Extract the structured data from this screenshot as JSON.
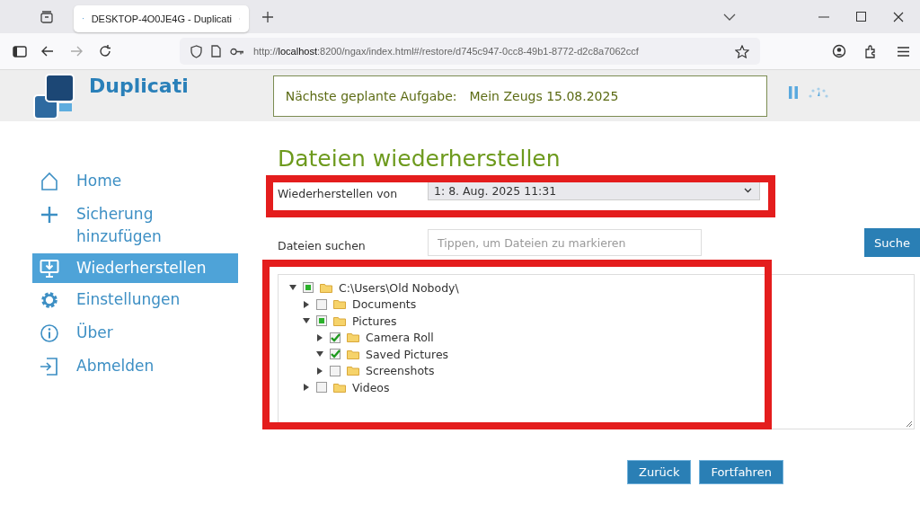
{
  "browser": {
    "tab_title": "DESKTOP-4O0JE4G - Duplicati",
    "url_prefix": "http://",
    "url_host": "localhost",
    "url_rest": ":8200/ngax/index.html#/restore/d745c947-0cc8-49b1-8772-d2c8a7062ccf"
  },
  "app": {
    "logo": "Duplicati",
    "next_task_label": "Nächste geplante Aufgabe:",
    "next_task_value": "Mein Zeugs 15.08.2025"
  },
  "sidebar": {
    "items": [
      {
        "label": "Home",
        "kind": "home",
        "selected": false
      },
      {
        "label": "Sicherung hinzufügen",
        "kind": "add",
        "selected": false
      },
      {
        "label": "Wiederherstellen",
        "kind": "restore",
        "selected": true
      },
      {
        "label": "Einstellungen",
        "kind": "settings",
        "selected": false
      },
      {
        "label": "Über",
        "kind": "about",
        "selected": false
      },
      {
        "label": "Abmelden",
        "kind": "logout",
        "selected": false
      }
    ]
  },
  "page": {
    "title": "Dateien wiederherstellen",
    "restore_from_label": "Wiederherstellen von",
    "restore_from_value": "1: 8. Aug. 2025 11:31",
    "search_label": "Dateien suchen",
    "search_placeholder": "Tippen, um Dateien zu markieren",
    "search_button": "Suche"
  },
  "tree": [
    {
      "label": "C:\\Users\\Old Nobody\\",
      "expanded": true,
      "checked": false,
      "partial": true,
      "children": [
        {
          "label": "Documents",
          "expanded": false,
          "checked": false,
          "partial": false
        },
        {
          "label": "Pictures",
          "expanded": true,
          "checked": false,
          "partial": true,
          "children": [
            {
              "label": "Camera Roll",
              "expanded": false,
              "checked": true,
              "partial": false
            },
            {
              "label": "Saved Pictures",
              "expanded": true,
              "checked": true,
              "partial": false
            },
            {
              "label": "Screenshots",
              "expanded": false,
              "checked": false,
              "partial": false
            }
          ]
        },
        {
          "label": "Videos",
          "expanded": false,
          "checked": false,
          "partial": false
        }
      ]
    }
  ],
  "buttons": [
    {
      "label": "Zurück"
    },
    {
      "label": "Fortfahren"
    }
  ]
}
